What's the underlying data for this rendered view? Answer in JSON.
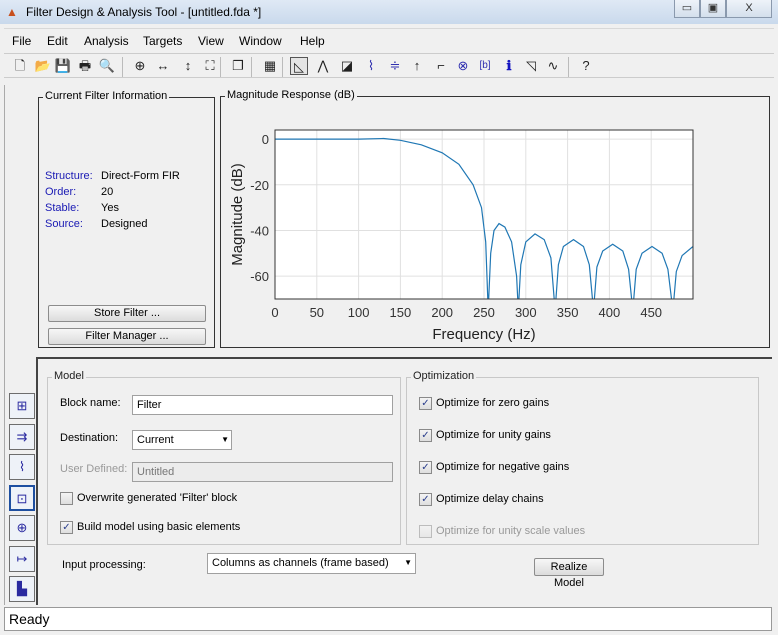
{
  "window": {
    "title": "Filter Design & Analysis Tool -  [untitled.fda *]",
    "minimize": "▭",
    "maximize": "▣",
    "close": "X"
  },
  "menu": [
    "File",
    "Edit",
    "Analysis",
    "Targets",
    "View",
    "Window",
    "Help"
  ],
  "toolbar": [
    "new-icon",
    "open-icon",
    "save-icon",
    "print-icon",
    "print-preview-icon",
    "zoom-in-icon",
    "zoom-x-icon",
    "zoom-y-icon",
    "full-view-icon",
    "new-figure-icon",
    "filter-full-view-icon",
    "magnitude-response-icon",
    "phase-response-icon",
    "magnitude-phase-icon",
    "group-delay-icon",
    "phase-delay-icon",
    "impulse-response-icon",
    "step-response-icon",
    "pole-zero-icon",
    "filter-coefficients-icon",
    "filter-info-icon",
    "magnitude-estimate-icon",
    "round-off-noise-icon",
    "whats-this-icon"
  ],
  "filter_info": {
    "title": "Current Filter Information",
    "rows": [
      {
        "k": "Structure:",
        "v": "Direct-Form FIR"
      },
      {
        "k": "Order:",
        "v": "20"
      },
      {
        "k": "Stable:",
        "v": "Yes"
      },
      {
        "k": "Source:",
        "v": "Designed"
      }
    ],
    "store_button": "Store Filter ...",
    "manager_button": "Filter Manager ..."
  },
  "chart_panel_title": "Magnitude Response (dB)",
  "chart_data": {
    "type": "line",
    "xlabel": "Frequency (Hz)",
    "ylabel": "Magnitude (dB)",
    "xlim": [
      0,
      500
    ],
    "ylim": [
      -70,
      4
    ],
    "xticks": [
      0,
      50,
      100,
      150,
      200,
      250,
      300,
      350,
      400,
      450
    ],
    "yticks": [
      0,
      -20,
      -40,
      -60
    ],
    "grid": true,
    "color": "#1f77b4",
    "points": [
      [
        0,
        0
      ],
      [
        50,
        0
      ],
      [
        100,
        0
      ],
      [
        130,
        0.3
      ],
      [
        150,
        -0.5
      ],
      [
        175,
        -2.5
      ],
      [
        200,
        -6
      ],
      [
        220,
        -11
      ],
      [
        237,
        -20
      ],
      [
        247,
        -30
      ],
      [
        252,
        -45
      ],
      [
        255,
        -75
      ],
      [
        258,
        -50
      ],
      [
        262,
        -40
      ],
      [
        268,
        -37
      ],
      [
        275,
        -38.5
      ],
      [
        283,
        -45
      ],
      [
        289,
        -60
      ],
      [
        291,
        -75
      ],
      [
        294,
        -55
      ],
      [
        300,
        -45
      ],
      [
        311,
        -41.5
      ],
      [
        322,
        -44
      ],
      [
        330,
        -52
      ],
      [
        335,
        -75
      ],
      [
        339,
        -55
      ],
      [
        345,
        -47
      ],
      [
        357,
        -44
      ],
      [
        369,
        -47
      ],
      [
        376,
        -55
      ],
      [
        381,
        -75
      ],
      [
        385,
        -56
      ],
      [
        392,
        -49
      ],
      [
        404,
        -46
      ],
      [
        416,
        -49
      ],
      [
        423,
        -57
      ],
      [
        428,
        -75
      ],
      [
        432,
        -57
      ],
      [
        439,
        -50
      ],
      [
        451,
        -47
      ],
      [
        463,
        -50
      ],
      [
        470,
        -57
      ],
      [
        476,
        -75
      ],
      [
        480,
        -58
      ],
      [
        487,
        -51
      ],
      [
        500,
        -47
      ]
    ]
  },
  "model": {
    "title": "Model",
    "block_name_label": "Block name:",
    "block_name": "Filter",
    "destination_label": "Destination:",
    "destination": "Current",
    "user_defined_label": "User Defined:",
    "user_defined": "Untitled",
    "overwrite_label": "Overwrite generated 'Filter' block",
    "overwrite": false,
    "basic_label": "Build model using basic elements",
    "basic": true
  },
  "optimization": {
    "title": "Optimization",
    "items": [
      {
        "label": "Optimize for zero gains",
        "checked": true
      },
      {
        "label": "Optimize for unity gains",
        "checked": true
      },
      {
        "label": "Optimize for negative gains",
        "checked": true
      },
      {
        "label": "Optimize delay chains",
        "checked": true
      },
      {
        "label": "Optimize for unity scale values",
        "checked": false,
        "disabled": true
      }
    ]
  },
  "input_processing_label": "Input processing:",
  "input_processing": "Columns as channels (frame based)",
  "realize_button": "Realize Model",
  "sidebar": [
    "transform-filter-icon",
    "convert-structure-icon",
    "quantize-icon",
    "realize-model-icon",
    "pole-zero-editor-icon",
    "import-filter-icon",
    "design-filter-icon"
  ],
  "status": "Ready"
}
